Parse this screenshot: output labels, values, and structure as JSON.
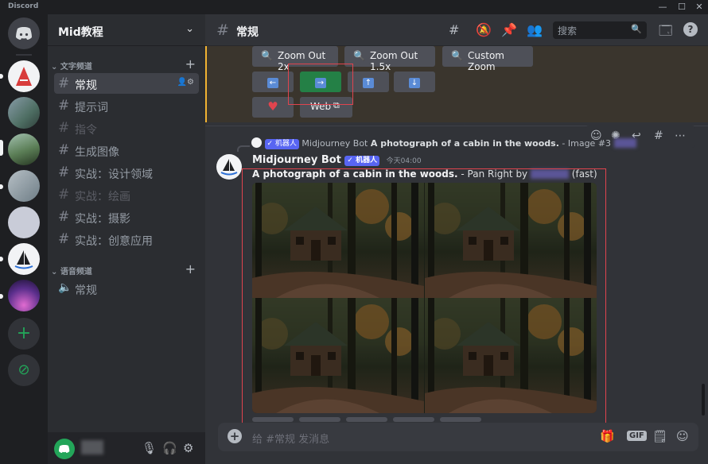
{
  "window": {
    "app_name": "Discord",
    "controls": [
      "—",
      "☐",
      "✕"
    ]
  },
  "server": {
    "name": "Mid教程"
  },
  "sidebar": {
    "text_category": "文字频道",
    "text_channels": [
      {
        "label": "常规",
        "active": true
      },
      {
        "label": "提示词"
      },
      {
        "label": "指令",
        "muted": true
      },
      {
        "label": "生成图像"
      },
      {
        "label": "实战：设计领域"
      },
      {
        "label": "实战：绘画",
        "muted": true
      },
      {
        "label": "实战：摄影"
      },
      {
        "label": "实战：创意应用"
      }
    ],
    "voice_category": "语音频道",
    "voice_channels": [
      {
        "label": "常规"
      }
    ]
  },
  "header": {
    "channel_name": "常规",
    "search_placeholder": "搜索"
  },
  "prev_message": {
    "zoom_buttons": [
      "Zoom Out 2x",
      "Zoom Out 1.5x",
      "Custom Zoom"
    ],
    "arrow_buttons": [
      "←",
      "→",
      "↑",
      "↓"
    ],
    "web_label": "Web"
  },
  "message": {
    "reply_badge": "✓ 机器人",
    "reply_author": "Midjourney Bot",
    "reply_text_bold": "A photograph of a cabin in the woods.",
    "reply_text_tail": " - Image #3",
    "author": "Midjourney Bot",
    "author_badge": "✓ 机器人",
    "timestamp": "今天04:00",
    "prompt_bold": "A photograph of a cabin in the woods.",
    "prompt_mid": " - Pan Right by ",
    "prompt_tail": " (fast)"
  },
  "composer": {
    "placeholder": "给 #常规 发消息",
    "gif_label": "GIF"
  },
  "colors": {
    "accent": "#5865f2",
    "green": "#248046",
    "highlight_border": "#f0b232",
    "annotation_red": "#e0444e"
  }
}
